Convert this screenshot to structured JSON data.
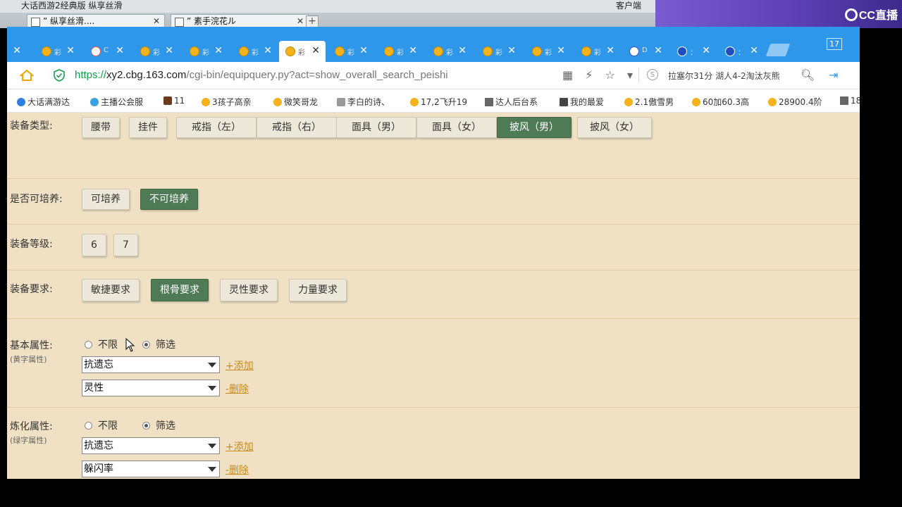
{
  "outer": {
    "top_text": "大话西游2经典版  纵享丝滑",
    "top_right": "客户端",
    "tabs": [
      {
        "label": "” 纵享丝滑...."
      },
      {
        "label": "” 素手浣花ル"
      }
    ]
  },
  "overlay": {
    "brand": "CC直播"
  },
  "browser": {
    "tab_count": "17",
    "tabs": [
      {
        "title": "彩"
      },
      {
        "title": "C"
      },
      {
        "title": "彩"
      },
      {
        "title": "彩"
      },
      {
        "title": "彩"
      },
      {
        "title": "彩"
      },
      {
        "title": "彩"
      },
      {
        "title": "彩"
      },
      {
        "title": "彩"
      },
      {
        "title": "彩"
      },
      {
        "title": "彩"
      },
      {
        "title": "彩"
      },
      {
        "title": "D"
      },
      {
        "title": "："
      },
      {
        "title": "："
      }
    ],
    "url": {
      "scheme": "https://",
      "domain": "xy2.cbg.163.com",
      "path": "/cgi-bin/equipquery.py?act=show_overall_search_peishi"
    },
    "search_text": "拉塞尔31分 湖人4-2淘汰灰熊",
    "bookmarks": [
      "大话满游达",
      "主播公会服",
      "11",
      "3孩子高亲",
      "微笑哥龙",
      "李白的诗、",
      "17,2飞升19",
      "达人后台系",
      "我的最爱",
      "2.1傲雪男",
      "60加60.3高",
      "28900.4阶",
      "18"
    ]
  },
  "form": {
    "equip_type": {
      "label": "装备类型:",
      "options": [
        "腰带",
        "挂件",
        "戒指（左）",
        "戒指（右）",
        "面具（男）",
        "面具（女）",
        "披风（男）",
        "披风（女）"
      ],
      "selected": "披风（男）"
    },
    "cultivable": {
      "label": "是否可培养:",
      "options": [
        "可培养",
        "不可培养"
      ],
      "selected": "不可培养"
    },
    "equip_level": {
      "label": "装备等级:",
      "options": [
        "6",
        "7"
      ]
    },
    "equip_req": {
      "label": "装备要求:",
      "options": [
        "敏捷要求",
        "根骨要求",
        "灵性要求",
        "力量要求"
      ],
      "selected": "根骨要求"
    },
    "basic_attr": {
      "label": "基本属性:",
      "sublabel": "(黄字属性)",
      "radio": [
        "不限",
        "筛选"
      ],
      "radio_selected": "筛选",
      "selects": [
        "抗遗忘",
        "灵性"
      ],
      "links": [
        "+添加",
        "-删除"
      ]
    },
    "refine_attr": {
      "label": "炼化属性:",
      "sublabel": "(绿字属性)",
      "radio": [
        "不限",
        "筛选"
      ],
      "radio_selected": "筛选",
      "selects": [
        "抗遗忘",
        "躲闪率"
      ],
      "links": [
        "+添加",
        "-删除"
      ]
    }
  }
}
